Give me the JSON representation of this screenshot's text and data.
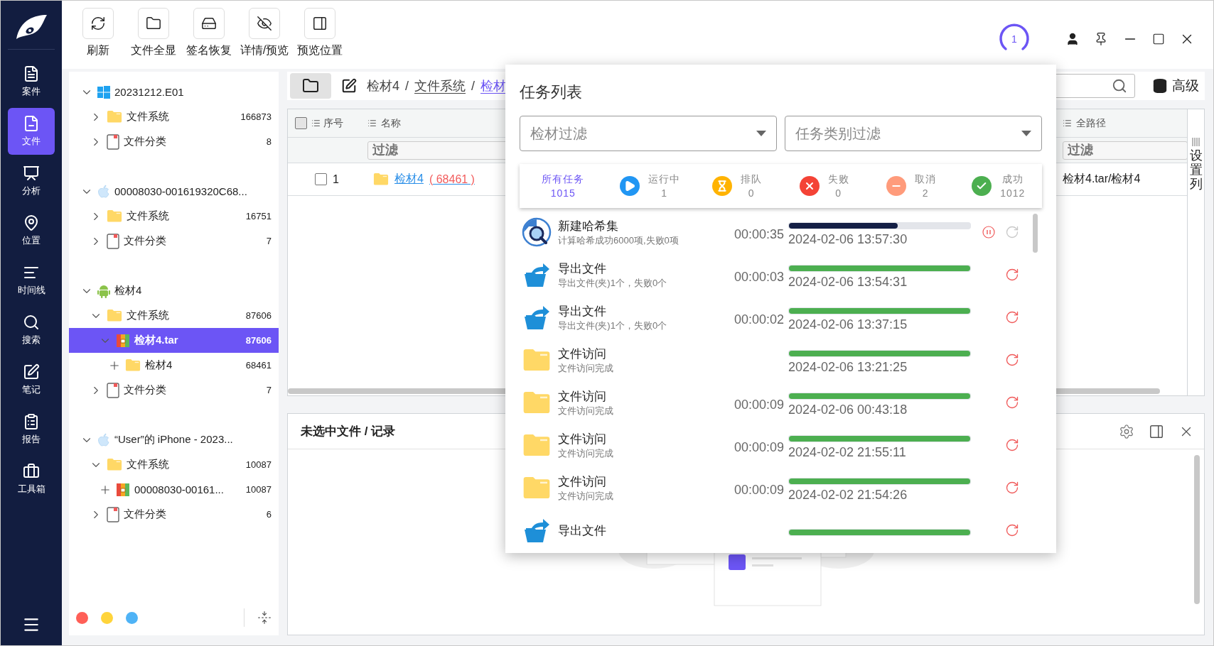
{
  "nav": {
    "items": [
      {
        "kind": "case",
        "label": "案件",
        "selected": false
      },
      {
        "kind": "file",
        "label": "文件",
        "selected": true
      },
      {
        "kind": "analysis",
        "label": "分析",
        "selected": false
      },
      {
        "kind": "location",
        "label": "位置",
        "selected": false
      },
      {
        "kind": "timeline",
        "label": "时间线",
        "selected": false
      },
      {
        "kind": "search",
        "label": "搜索",
        "selected": false
      },
      {
        "kind": "notes",
        "label": "笔记",
        "selected": false
      },
      {
        "kind": "report",
        "label": "报告",
        "selected": false
      },
      {
        "kind": "toolbox",
        "label": "工具箱",
        "selected": false
      }
    ]
  },
  "toolbar": [
    {
      "kind": "refresh",
      "label": "刷新"
    },
    {
      "kind": "folder",
      "label": "文件全显"
    },
    {
      "kind": "disk",
      "label": "签名恢复"
    },
    {
      "kind": "eye-off",
      "label": "详情/预览"
    },
    {
      "kind": "panel",
      "label": "预览位置"
    }
  ],
  "task_counter": "1",
  "tree": {
    "groups": [
      {
        "label": "20231212.E01",
        "kind": "windows",
        "expanded": true,
        "selected": false,
        "children": [
          {
            "label": "文件系统",
            "kind": "folder",
            "count": "166873",
            "lazy": false,
            "expanded": false,
            "selected": false
          },
          {
            "label": "文件分类",
            "kind": "document",
            "count": "8",
            "lazy": false,
            "expanded": false,
            "selected": false
          }
        ]
      },
      {
        "label": "00008030-001619320C68...",
        "kind": "apple",
        "expanded": true,
        "selected": false,
        "children": [
          {
            "label": "文件系统",
            "kind": "folder",
            "count": "16751",
            "lazy": false,
            "expanded": false,
            "selected": false
          },
          {
            "label": "文件分类",
            "kind": "document",
            "count": "7",
            "lazy": false,
            "expanded": false,
            "selected": false
          }
        ]
      },
      {
        "label": "检材4",
        "kind": "android",
        "expanded": true,
        "selected": false,
        "children": [
          {
            "label": "文件系统",
            "kind": "folder",
            "count": "87606",
            "lazy": false,
            "expanded": true,
            "selected": false,
            "children": [
              {
                "label": "检材4.tar",
                "kind": "archive",
                "count": "87606",
                "lazy": false,
                "expanded": true,
                "selected": true,
                "children": [
                  {
                    "label": "检材4",
                    "kind": "folder",
                    "count": "68461",
                    "lazy": true,
                    "expanded": false,
                    "selected": false
                  }
                ]
              }
            ]
          },
          {
            "label": "文件分类",
            "kind": "document",
            "count": "7",
            "lazy": false,
            "expanded": false,
            "selected": false
          }
        ]
      },
      {
        "label": "“User”的 iPhone - 2023...",
        "kind": "apple",
        "expanded": true,
        "selected": false,
        "children": [
          {
            "label": "文件系统",
            "kind": "folder",
            "count": "10087",
            "lazy": false,
            "expanded": true,
            "selected": false,
            "children": [
              {
                "label": "00008030-00161...",
                "kind": "archive",
                "count": "10087",
                "lazy": true,
                "expanded": false,
                "selected": false
              }
            ]
          },
          {
            "label": "文件分类",
            "kind": "document",
            "count": "6",
            "lazy": false,
            "expanded": false,
            "selected": false
          }
        ]
      }
    ],
    "color_dots": [
      {
        "color": "#ff5f57"
      },
      {
        "color": "#ffd43b"
      },
      {
        "color": "#4fb3f6"
      }
    ]
  },
  "breadcrumb": {
    "separator": "/",
    "parts": [
      {
        "label": "检材4",
        "kind": "plain"
      },
      {
        "label": "文件系统",
        "kind": "link"
      },
      {
        "label": "检材",
        "kind": "current"
      }
    ]
  },
  "advanced_button": "高级",
  "table": {
    "header_checked": false,
    "columns": [
      {
        "label": "序号"
      },
      {
        "label": "名称",
        "filter": {
          "placeholder": "过滤"
        }
      },
      {
        "label": "全路径",
        "filter": {
          "placeholder": "过滤"
        }
      }
    ],
    "rows": [
      {
        "checked": false,
        "index": "1",
        "name": "检材4",
        "count": "( 68461 )",
        "path": "检材4.tar/检材4"
      }
    ],
    "settings_label": "设置列"
  },
  "preview": {
    "title": "未选中文件 / 记录"
  },
  "task_panel": {
    "title": "任务列表",
    "filters": [
      {
        "placeholder": "检材过滤"
      },
      {
        "placeholder": "任务类别过滤"
      }
    ],
    "stats": [
      {
        "kind": "all",
        "label": "所有任务",
        "count": "1015",
        "selected": true
      },
      {
        "kind": "running",
        "label": "运行中",
        "count": "1",
        "selected": false
      },
      {
        "kind": "queued",
        "label": "排队",
        "count": "0",
        "selected": false
      },
      {
        "kind": "failed",
        "label": "失败",
        "count": "0",
        "selected": false
      },
      {
        "kind": "cancelled",
        "label": "取消",
        "count": "2",
        "selected": false
      },
      {
        "kind": "success",
        "label": "成功",
        "count": "1012",
        "selected": false
      }
    ],
    "tasks": [
      {
        "kind": "hash",
        "title": "新建哈希集",
        "subtitle": "计算哈希成功6000项,失败0项",
        "duration": "00:00:35",
        "level": 0.6,
        "date": "2024-02-06 13:57:30",
        "running": true
      },
      {
        "kind": "export",
        "title": "导出文件",
        "subtitle": "导出文件(夹)1个，失败0个",
        "duration": "00:00:03",
        "level": 1,
        "date": "2024-02-06 13:54:31",
        "running": false
      },
      {
        "kind": "export",
        "title": "导出文件",
        "subtitle": "导出文件(夹)1个，失败0个",
        "duration": "00:00:02",
        "level": 1,
        "date": "2024-02-06 13:37:15",
        "running": false
      },
      {
        "kind": "folder",
        "title": "文件访问",
        "subtitle": "文件访问完成",
        "level": 1,
        "date": "2024-02-06 13:21:25",
        "running": false
      },
      {
        "kind": "folder",
        "title": "文件访问",
        "subtitle": "文件访问完成",
        "duration": "00:00:09",
        "level": 1,
        "date": "2024-02-06 00:43:18",
        "running": false
      },
      {
        "kind": "folder",
        "title": "文件访问",
        "subtitle": "文件访问完成",
        "duration": "00:00:09",
        "level": 1,
        "date": "2024-02-02 21:55:11",
        "running": false
      },
      {
        "kind": "folder",
        "title": "文件访问",
        "subtitle": "文件访问完成",
        "duration": "00:00:09",
        "level": 1,
        "date": "2024-02-02 21:54:26",
        "running": false
      },
      {
        "kind": "export",
        "title": "导出文件",
        "level": 1,
        "running": false
      }
    ]
  }
}
